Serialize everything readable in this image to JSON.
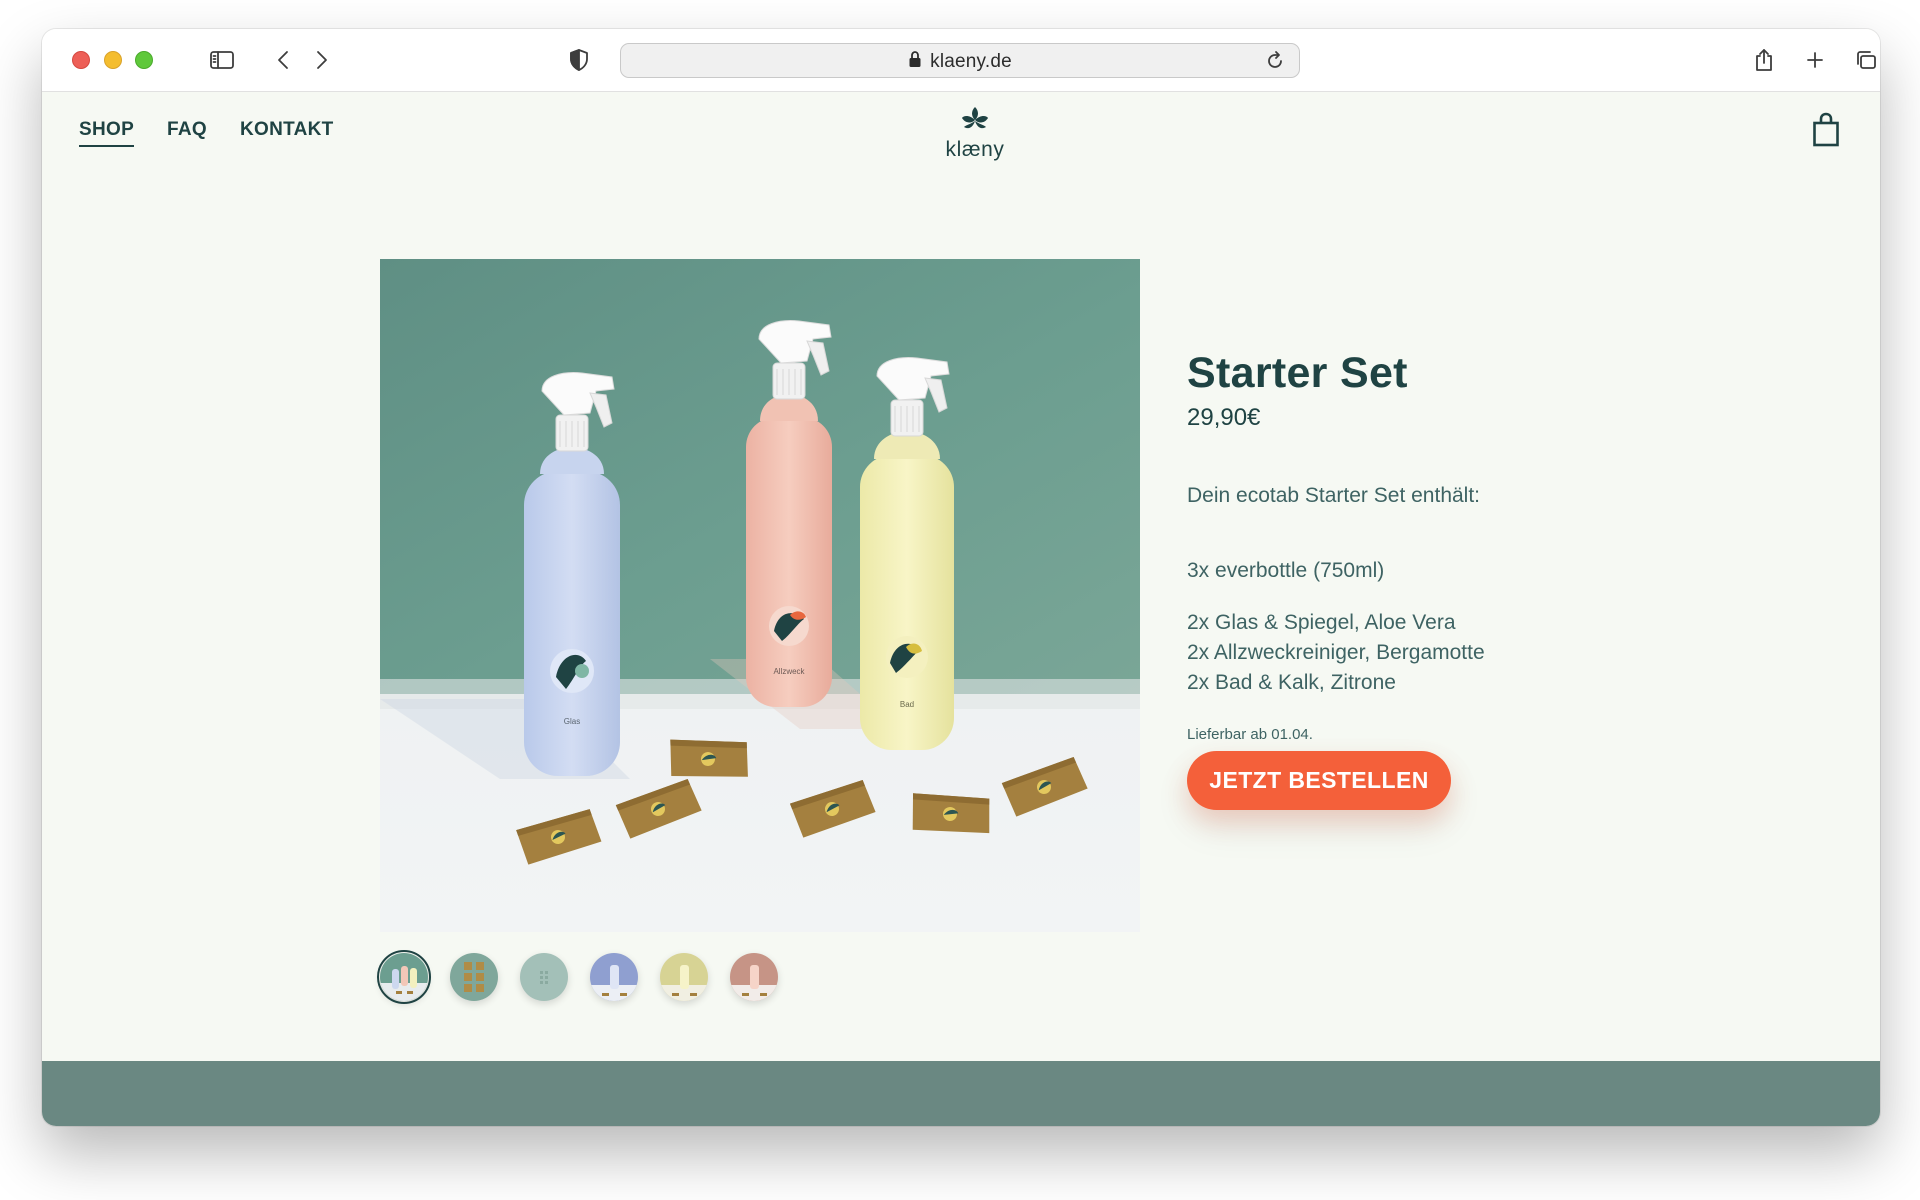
{
  "browser": {
    "url": "klaeny.de"
  },
  "nav": {
    "items": [
      {
        "label": "SHOP",
        "active": true
      },
      {
        "label": "FAQ",
        "active": false
      },
      {
        "label": "KONTAKT",
        "active": false
      }
    ]
  },
  "brand": {
    "name": "klæny"
  },
  "product": {
    "title": "Starter Set",
    "price": "29,90€",
    "description": "Dein ecotab Starter Set enthält:",
    "contents_bottles": "3x everbottle (750ml)",
    "contents_tabs": [
      "2x Glas & Spiegel, Aloe Vera",
      "2x Allzweckreiniger, Bergamotte",
      "2x Bad & Kalk, Zitrone"
    ],
    "availability": "Lieferbar ab 01.04.",
    "order_button": "JETZT BESTELLEN"
  },
  "image_labels": {
    "bottle_left": "Glas",
    "bottle_middle": "Allzweck",
    "bottle_right": "Bad"
  },
  "thumbnails": [
    {
      "label": "set",
      "active": true
    },
    {
      "label": "tabs",
      "active": false
    },
    {
      "label": "packaging",
      "active": false
    },
    {
      "label": "blue bottle",
      "active": false
    },
    {
      "label": "yellow bottle",
      "active": false
    },
    {
      "label": "pink bottle",
      "active": false
    }
  ],
  "colors": {
    "accent": "#f4603a",
    "brand_dark": "#1f4343",
    "page_background": "#f6f9f3",
    "footer": "#6a8882",
    "photo_wall": "#6c9e90"
  }
}
